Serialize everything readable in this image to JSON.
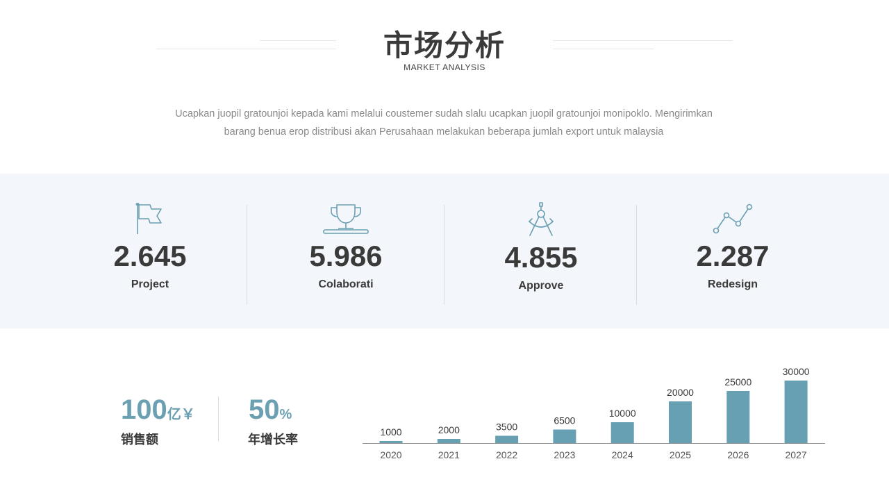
{
  "header": {
    "title": "市场分析",
    "subtitle": "MARKET ANALYSIS"
  },
  "description": {
    "line1": "Ucapkan juopil gratounjoi kepada kami melalui coustemer sudah slalu ucapkan juopil gratounjoi monipoklo. Mengirimkan",
    "line2": "barang benua erop distribusi akan Perusahaan melakukan beberapa jumlah export untuk malaysia"
  },
  "stats": [
    {
      "value": "2.645",
      "label": "Project",
      "icon": "flag-icon"
    },
    {
      "value": "5.986",
      "label": "Colaborati",
      "icon": "trophy-icon"
    },
    {
      "value": "4.855",
      "label": "Approve",
      "icon": "compass-icon"
    },
    {
      "value": "2.287",
      "label": "Redesign",
      "icon": "line-chart-icon"
    }
  ],
  "kpis": [
    {
      "number": "100",
      "unit": "亿￥",
      "label": "销售额"
    },
    {
      "number": "50",
      "unit": "%",
      "label": "年增长率"
    }
  ],
  "colors": {
    "accent": "#6b9fb2",
    "bar": "#679fb3",
    "band": "#f3f6fa",
    "text": "#3a3a3a"
  },
  "chart_data": {
    "type": "bar",
    "categories": [
      "2020",
      "2021",
      "2022",
      "2023",
      "2024",
      "2025",
      "2026",
      "2027"
    ],
    "values": [
      1000,
      2000,
      3500,
      6500,
      10000,
      20000,
      25000,
      30000
    ],
    "ylim": [
      0,
      30000
    ],
    "grid": false,
    "legend": "none"
  }
}
